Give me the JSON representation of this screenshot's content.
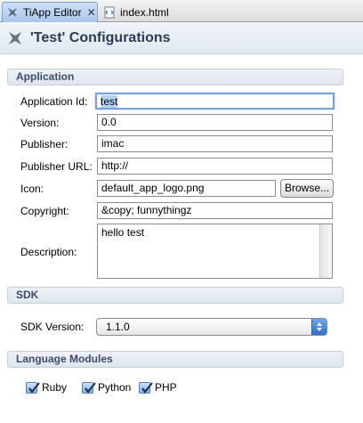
{
  "tabs": [
    {
      "label": "TiApp Editor",
      "close": "✕",
      "icon": "titanium-icon",
      "active": true
    },
    {
      "label": "index.html",
      "icon": "html-file-icon",
      "active": false
    }
  ],
  "page_title": "'Test' Configurations",
  "application": {
    "header": "Application",
    "app_id_label": "Application Id:",
    "app_id_value": "test",
    "version_label": "Version:",
    "version_value": "0.0",
    "publisher_label": "Publisher:",
    "publisher_value": "imac",
    "publisher_url_label": "Publisher URL:",
    "publisher_url_value": "http://",
    "icon_label": "Icon:",
    "icon_value": "default_app_logo.png",
    "browse_label": "Browse...",
    "copyright_label": "Copyright:",
    "copyright_value": "&copy; funnythingz",
    "description_label": "Description:",
    "description_value": "hello test"
  },
  "sdk": {
    "header": "SDK",
    "version_label": "SDK Version:",
    "version_selected": "1.1.0"
  },
  "modules": {
    "header": "Language Modules",
    "items": [
      {
        "label": "Ruby",
        "checked": true
      },
      {
        "label": "Python",
        "checked": true
      },
      {
        "label": "PHP",
        "checked": true
      }
    ]
  }
}
